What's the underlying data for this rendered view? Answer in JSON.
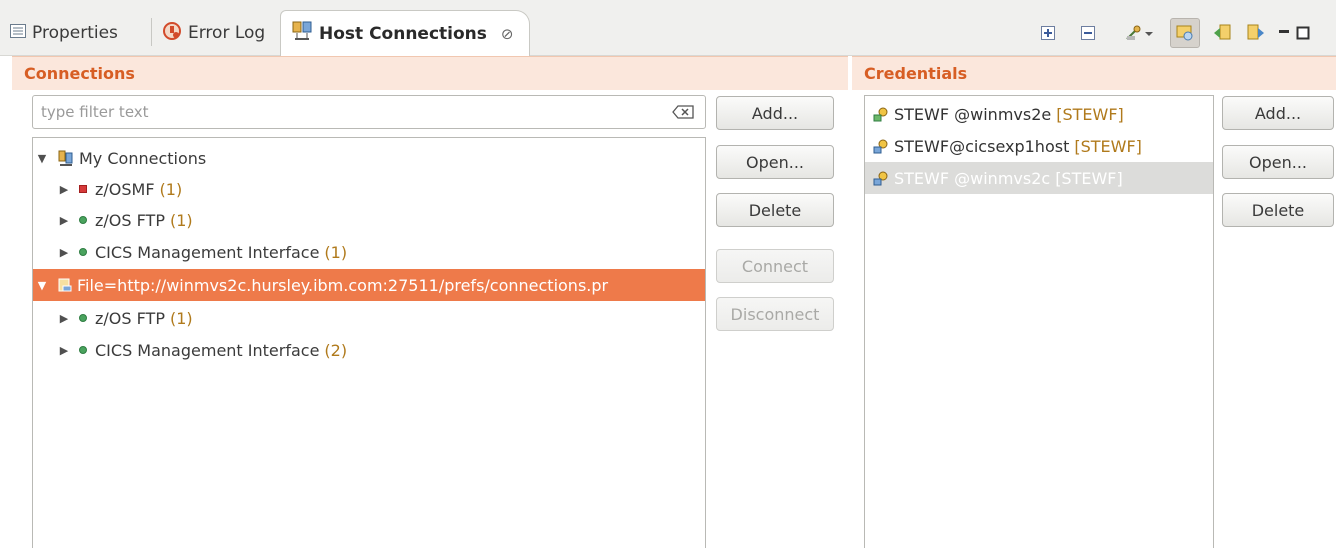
{
  "tabs": [
    {
      "label": "Properties",
      "icon": "properties-icon"
    },
    {
      "label": "Error Log",
      "icon": "error-log-icon"
    },
    {
      "label": "Host Connections",
      "icon": "host-connections-icon",
      "active": true,
      "close": "⊘"
    }
  ],
  "toolbar": {
    "icons": [
      "expand-all-icon",
      "collapse-all-icon",
      "connection-menu-icon",
      "link-icon",
      "import-icon",
      "export-icon",
      "minimize-icon",
      "maximize-icon"
    ]
  },
  "connections": {
    "title": "Connections",
    "filter": {
      "placeholder": "type filter text",
      "value": ""
    },
    "tree": [
      {
        "label": "My Connections",
        "count": "",
        "level": 0,
        "expanded": true,
        "icon": "connections-folder-icon"
      },
      {
        "label": "z/OSMF",
        "count": "(1)",
        "level": 1,
        "icon": "red-square-icon"
      },
      {
        "label": "z/OS FTP",
        "count": "(1)",
        "level": 1,
        "icon": "green-dot-icon"
      },
      {
        "label": "CICS Management Interface",
        "count": "(1)",
        "level": 1,
        "icon": "green-dot-icon"
      },
      {
        "label": "File=http://winmvs2c.hursley.ibm.com:27511/prefs/connections.pr",
        "count": "",
        "level": 0,
        "expanded": true,
        "selected": true,
        "icon": "file-connections-icon"
      },
      {
        "label": "z/OS FTP",
        "count": "(1)",
        "level": 1,
        "icon": "green-dot-icon"
      },
      {
        "label": "CICS Management Interface",
        "count": "(2)",
        "level": 1,
        "icon": "green-dot-icon"
      }
    ],
    "buttons": {
      "add": "Add...",
      "open": "Open...",
      "delete": "Delete",
      "connect": "Connect",
      "disconnect": "Disconnect"
    }
  },
  "credentials": {
    "title": "Credentials",
    "items": [
      {
        "label": "STEWF @winmvs2e",
        "tag": "[STEWF]"
      },
      {
        "label": "STEWF@cicsexp1host",
        "tag": "[STEWF]"
      },
      {
        "label": "STEWF @winmvs2c",
        "tag": "[STEWF]",
        "selected": true
      }
    ],
    "buttons": {
      "add": "Add...",
      "open": "Open...",
      "delete": "Delete"
    }
  },
  "colors": {
    "accent": "#ee7a4a",
    "section_title": "#d75e24",
    "section_header_bg": "#fbe7dc",
    "count": "#b07a1c"
  }
}
